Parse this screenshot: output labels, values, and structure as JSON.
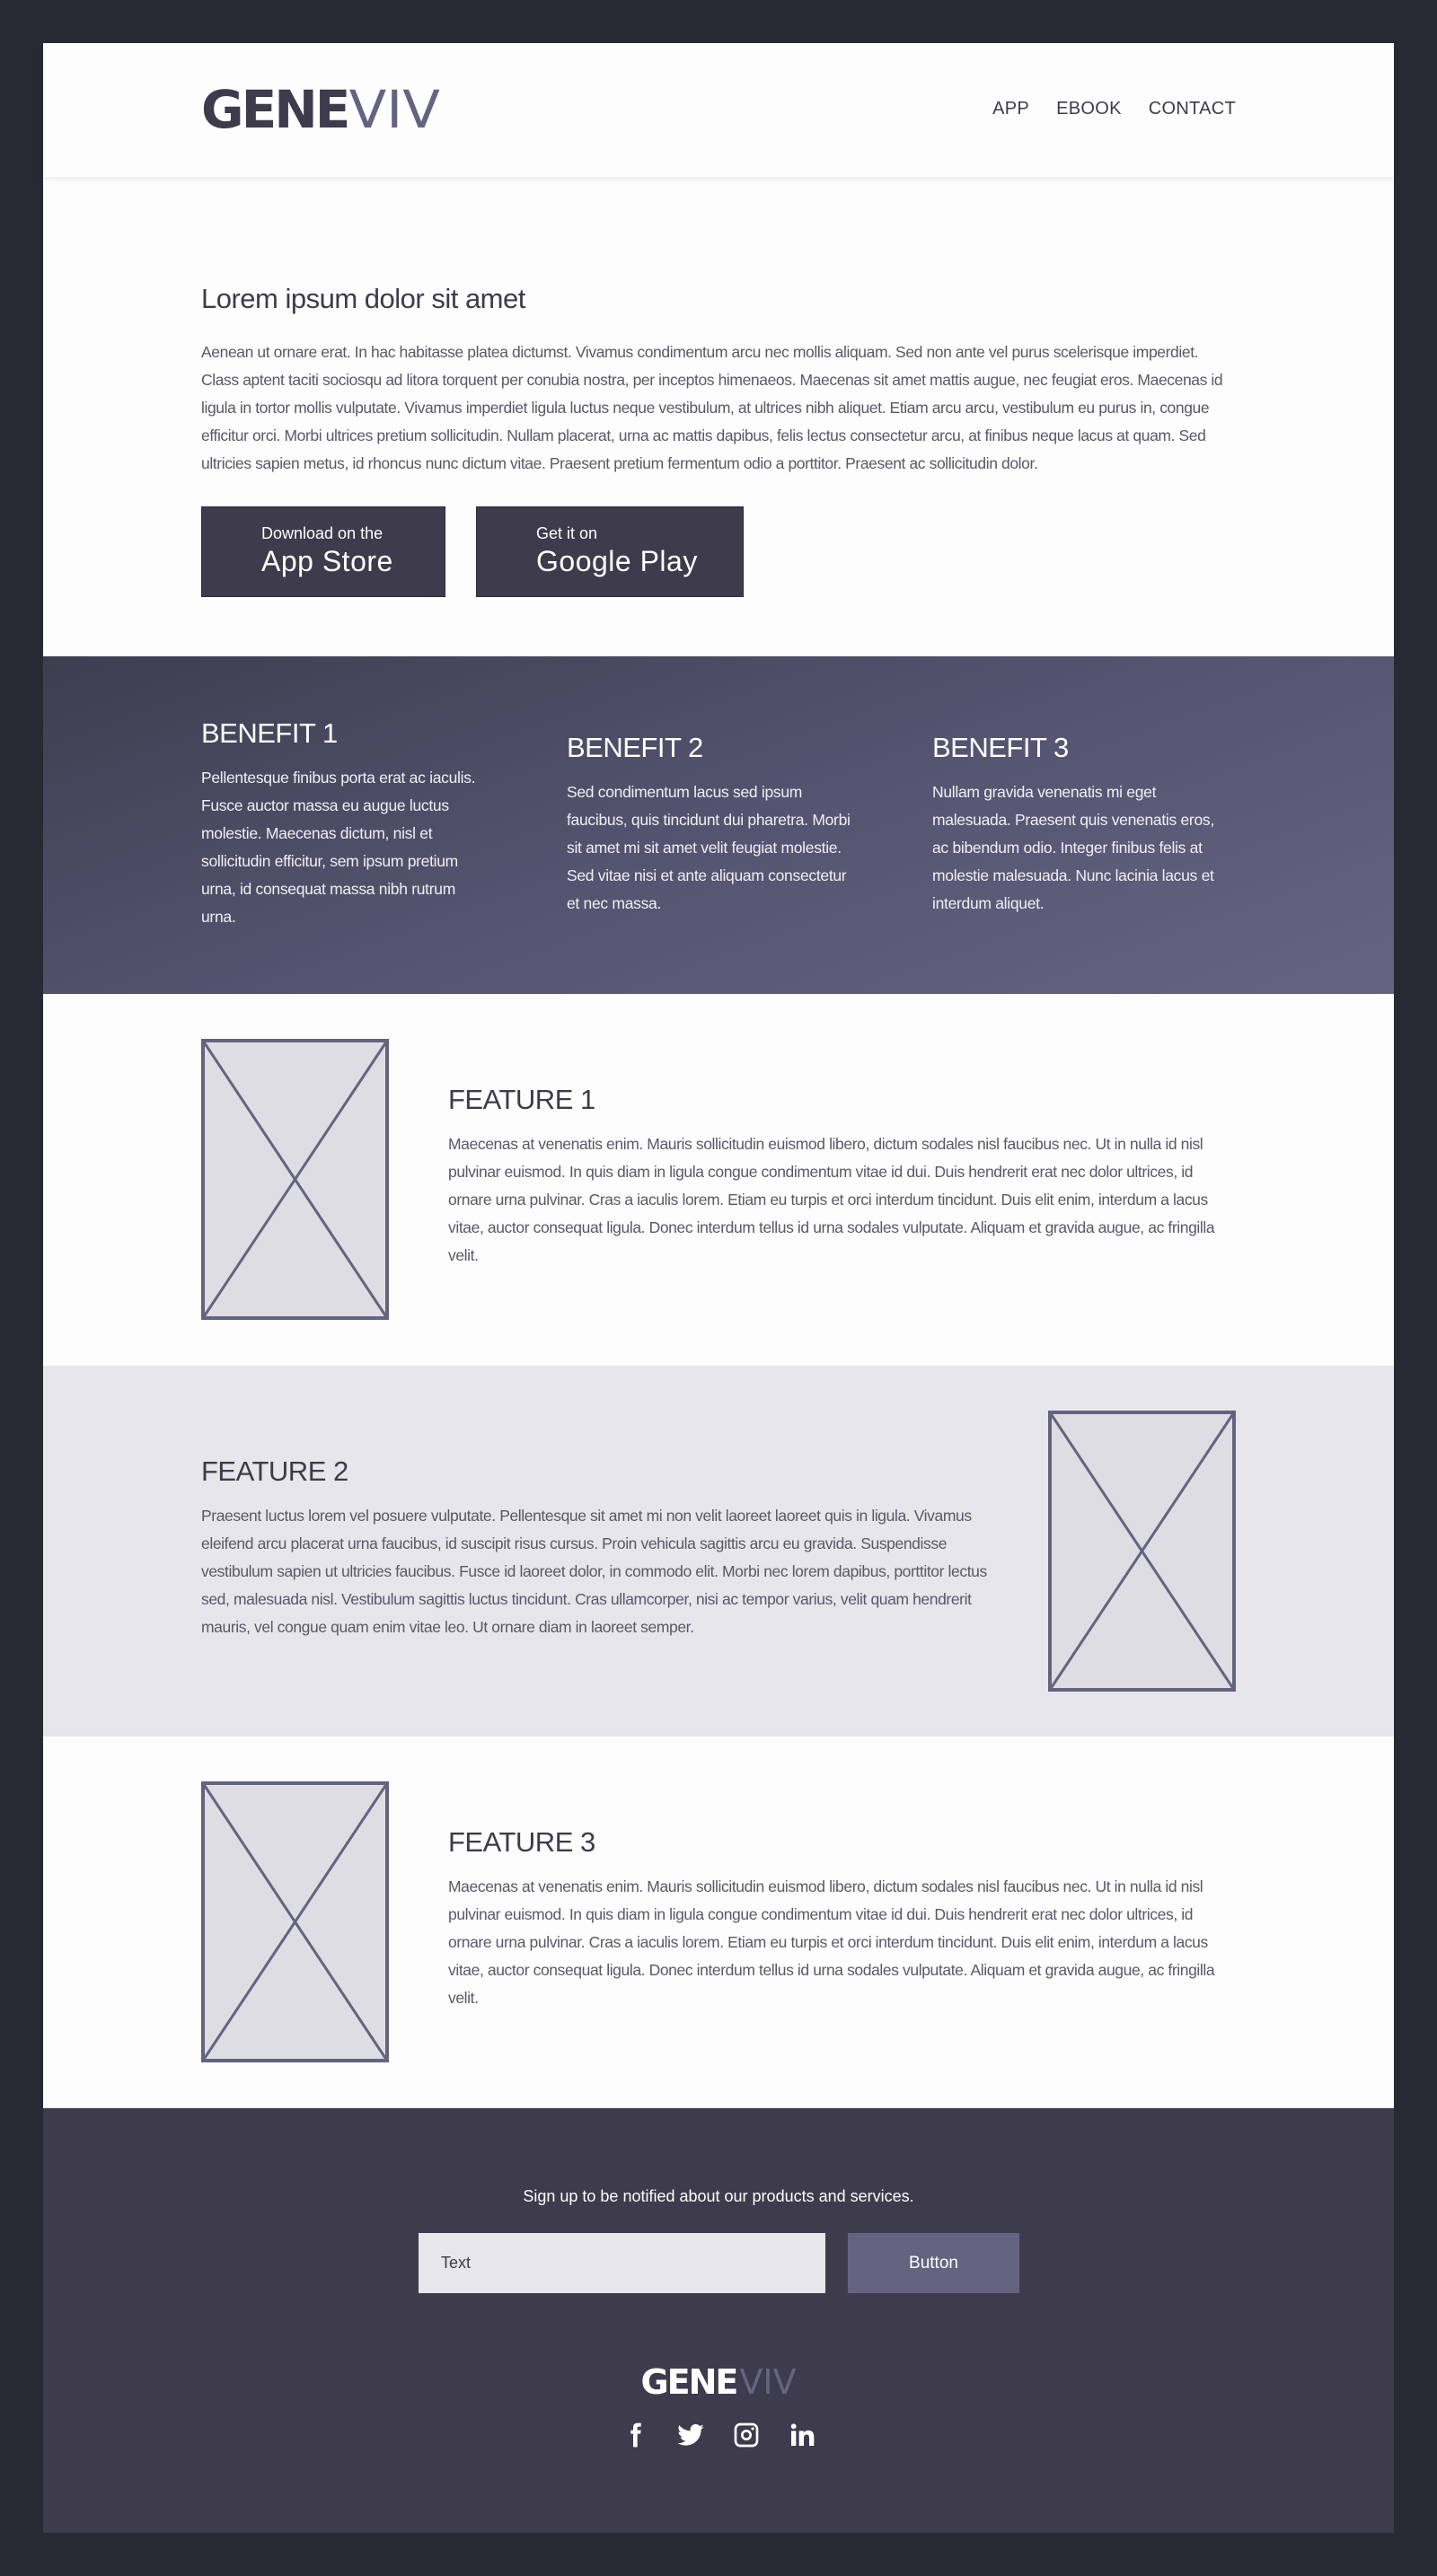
{
  "colors": {
    "frame": "#292933",
    "dark": "#3d3b4c",
    "accent": "#646380",
    "light_bg": "#e7e6eb",
    "white": "#fdfdfe"
  },
  "header": {
    "logo": {
      "part1": "GENE",
      "part2": "VIV"
    },
    "nav": [
      {
        "label": "APP"
      },
      {
        "label": "EBOOK"
      },
      {
        "label": "CONTACT"
      }
    ]
  },
  "hero": {
    "title": "Lorem ipsum dolor sit amet",
    "body": "Aenean ut ornare erat. In hac habitasse platea dictumst. Vivamus condimentum arcu nec mollis aliquam. Sed non ante vel purus scelerisque imperdiet. Class aptent taciti sociosqu ad litora torquent per conubia nostra, per inceptos himenaeos. Maecenas sit amet mattis augue, nec feugiat eros. Maecenas id ligula in tortor mollis vulputate. Vivamus imperdiet ligula luctus neque vestibulum, at ultrices nibh aliquet. Etiam arcu arcu, vestibulum eu purus in, congue efficitur orci. Morbi ultrices pretium sollicitudin. Nullam placerat, urna ac mattis dapibus, felis lectus consectetur arcu, at finibus neque lacus at quam. Sed ultricies sapien metus, id rhoncus nunc dictum vitae. Praesent pretium fermentum odio a porttitor. Praesent ac sollicitudin dolor.",
    "app_store": {
      "small": "Download on the",
      "big": "App Store"
    },
    "google_play": {
      "small": "Get it on",
      "big": "Google Play"
    }
  },
  "benefits": [
    {
      "title": "BENEFIT 1",
      "body": "Pellentesque finibus porta erat ac iaculis. Fusce auctor massa eu augue luctus molestie. Maecenas dictum, nisl et sollicitudin efficitur, sem ipsum pretium urna, id consequat massa nibh rutrum urna."
    },
    {
      "title": "BENEFIT 2",
      "body": "Sed condimentum lacus sed ipsum faucibus, quis tincidunt dui pharetra. Morbi sit amet mi sit amet velit feugiat molestie. Sed vitae nisi et ante aliquam consectetur et nec massa."
    },
    {
      "title": "BENEFIT 3",
      "body": "Nullam gravida venenatis mi eget malesuada. Praesent quis venenatis eros, ac bibendum odio. Integer finibus felis at molestie malesuada. Nunc lacinia lacus et interdum aliquet."
    }
  ],
  "features": [
    {
      "title": "FEATURE 1",
      "body": "Maecenas at venenatis enim. Mauris sollicitudin euismod libero, dictum sodales nisl faucibus nec. Ut in nulla id nisl pulvinar euismod. In quis diam in ligula congue condimentum vitae id dui. Duis hendrerit erat nec dolor ultrices, id ornare urna pulvinar. Cras a iaculis lorem. Etiam eu turpis et orci interdum tincidunt. Duis elit enim, interdum a lacus vitae, auctor consequat ligula. Donec interdum tellus id urna sodales vulputate. Aliquam et gravida augue, ac fringilla velit."
    },
    {
      "title": "FEATURE 2",
      "body": "Praesent luctus lorem vel posuere vulputate. Pellentesque sit amet mi non velit laoreet laoreet quis in ligula. Vivamus eleifend arcu placerat urna faucibus, id suscipit risus cursus. Proin vehicula sagittis arcu eu gravida. Suspendisse vestibulum sapien ut ultricies faucibus. Fusce id laoreet dolor, in commodo elit. Morbi nec lorem dapibus, porttitor lectus sed, malesuada nisl. Vestibulum sagittis luctus tincidunt. Cras ullamcorper, nisi ac tempor varius, velit quam hendrerit mauris, vel congue quam enim vitae leo. Ut ornare diam in laoreet semper."
    },
    {
      "title": "FEATURE 3",
      "body": "Maecenas at venenatis enim. Mauris sollicitudin euismod libero, dictum sodales nisl faucibus nec. Ut in nulla id nisl pulvinar euismod. In quis diam in ligula congue condimentum vitae id dui. Duis hendrerit erat nec dolor ultrices, id ornare urna pulvinar. Cras a iaculis lorem. Etiam eu turpis et orci interdum tincidunt. Duis elit enim, interdum a lacus vitae, auctor consequat ligula. Donec interdum tellus id urna sodales vulputate. Aliquam et gravida augue, ac fringilla velit."
    }
  ],
  "footer": {
    "signup_text": "Sign up to be notified about our products and services.",
    "input_placeholder": "Text",
    "button_label": "Button",
    "logo": {
      "part1": "GENE",
      "part2": "VIV"
    },
    "social": [
      {
        "icon": "facebook-icon"
      },
      {
        "icon": "twitter-icon"
      },
      {
        "icon": "instagram-icon"
      },
      {
        "icon": "linkedin-icon"
      }
    ]
  }
}
